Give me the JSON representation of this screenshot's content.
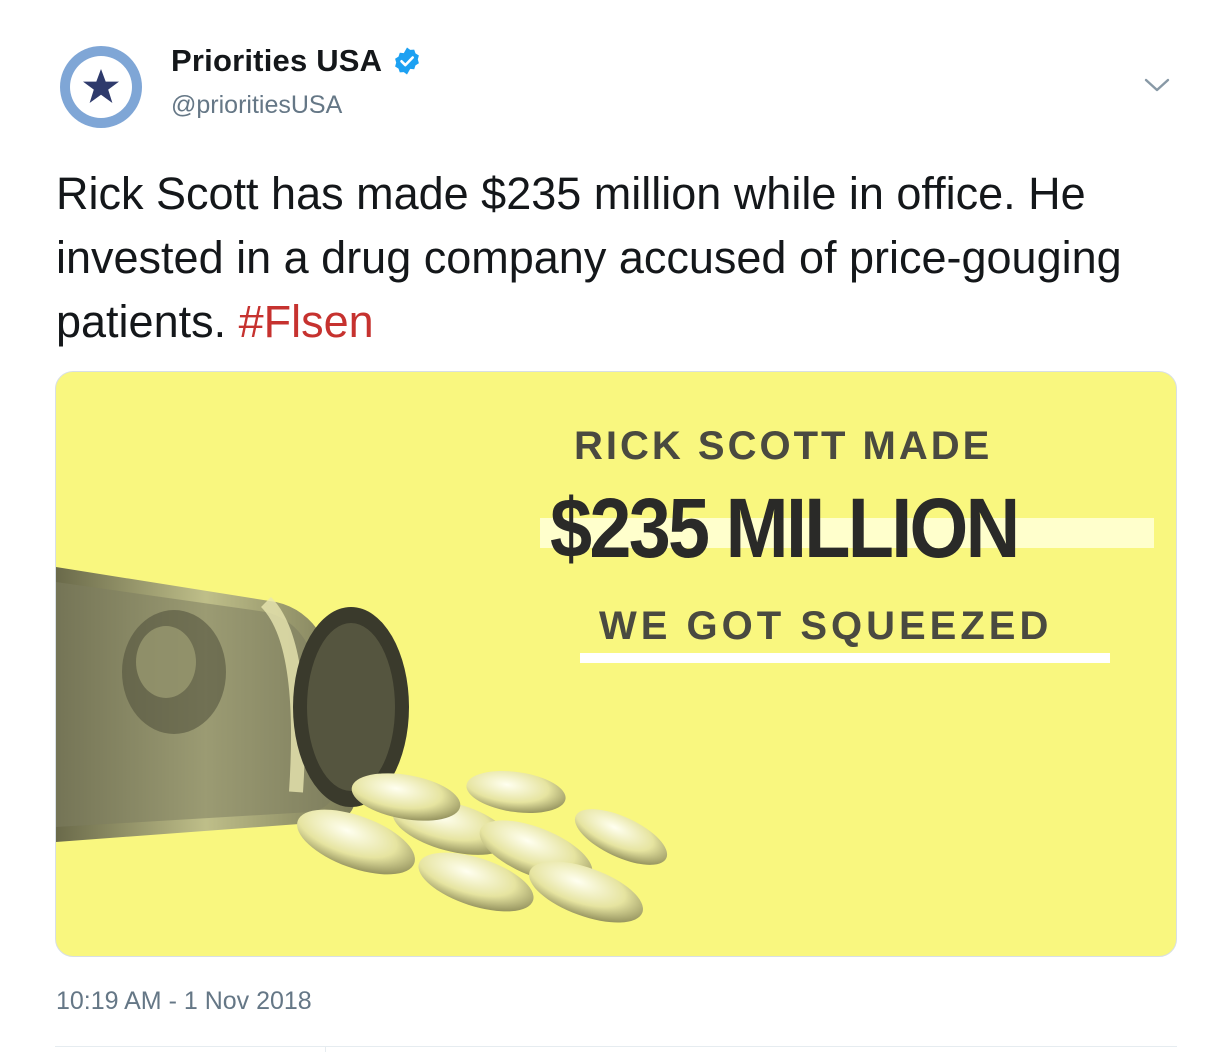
{
  "account": {
    "display_name": "Priorities USA",
    "handle": "@prioritiesUSA",
    "verified": true,
    "avatar_icon": "star-logo-icon",
    "avatar_colors": {
      "ring": "#7fa6d6",
      "star": "#2e3a6c"
    }
  },
  "tweet": {
    "text": "Rick Scott has made $235 million while in office. He invested in a drug company accused of price-gouging patients. ",
    "hashtag": "#Flsen",
    "hashtag_color": "#c6322f",
    "timestamp": "10:19 AM - 1 Nov 2018"
  },
  "media": {
    "line1": "RICK SCOTT MADE",
    "line2": "$235 MILLION",
    "line3": "WE GOT SQUEEZED",
    "background_color": "#f9f77f",
    "image_icon": "money-pill-bottle-icon"
  },
  "menu": {
    "icon": "chevron-down-icon"
  }
}
